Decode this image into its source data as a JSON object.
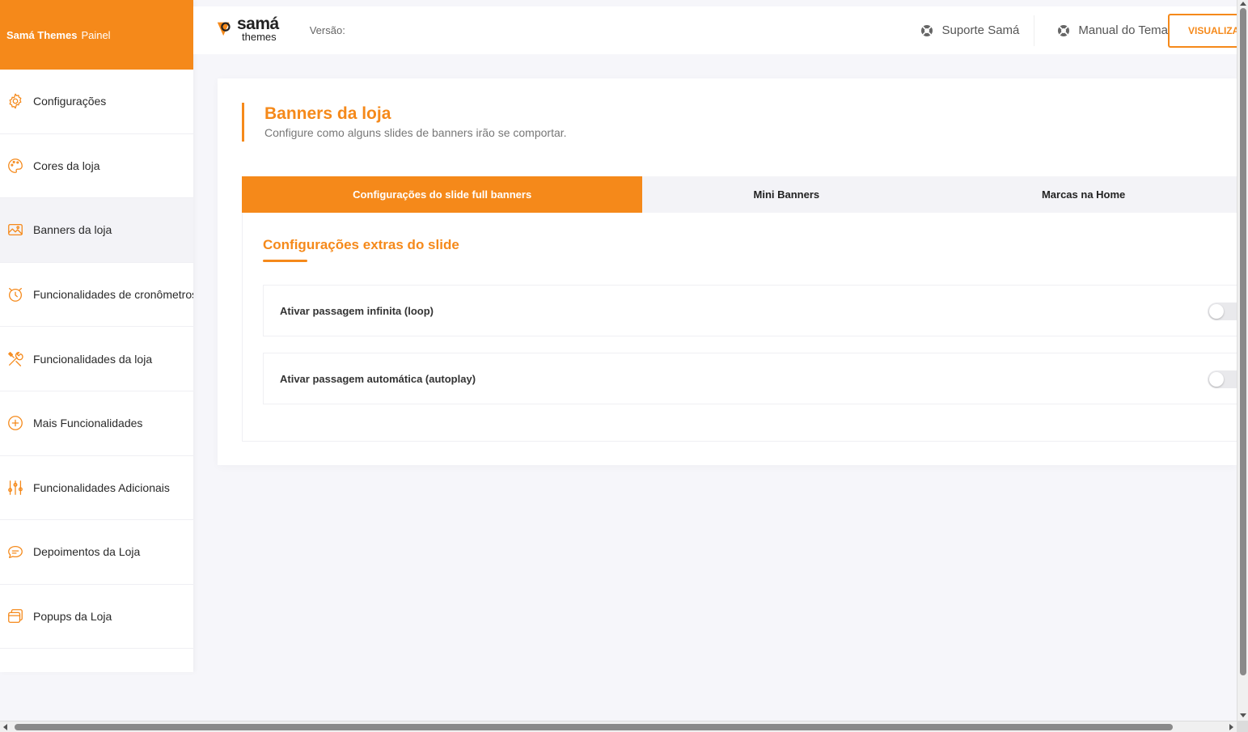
{
  "brand": {
    "name": "Samá Themes",
    "suffix": "Painel"
  },
  "colors": {
    "accent": "#f5891a",
    "background": "#f6f6fa"
  },
  "sidebar": {
    "items": [
      {
        "label": "Configurações",
        "icon": "gear-icon",
        "active": false
      },
      {
        "label": "Cores da loja",
        "icon": "palette-icon",
        "active": false
      },
      {
        "label": "Banners da loja",
        "icon": "image-icon",
        "active": true
      },
      {
        "label": "Funcionalidades de cronômetros",
        "icon": "alarm-clock-icon",
        "active": false
      },
      {
        "label": "Funcionalidades da loja",
        "icon": "tools-icon",
        "active": false
      },
      {
        "label": "Mais Funcionalidades",
        "icon": "plus-circle-icon",
        "active": false
      },
      {
        "label": "Funcionalidades Adicionais",
        "icon": "sliders-icon",
        "active": false
      },
      {
        "label": "Depoimentos da Loja",
        "icon": "chat-icon",
        "active": false
      },
      {
        "label": "Popups da Loja",
        "icon": "window-icon",
        "active": false
      }
    ]
  },
  "header": {
    "logo_line1": "samá",
    "logo_line2": "themes",
    "version_label": "Versão:",
    "links": [
      {
        "label": "Suporte Samá",
        "icon": "lifebuoy-icon"
      },
      {
        "label": "Manual do Tema",
        "icon": "lifebuoy-icon"
      }
    ],
    "visualize_button": "VISUALIZAR"
  },
  "page": {
    "title": "Banners da loja",
    "subtitle": "Configure como alguns slides de banners irão se comportar.",
    "tabs": [
      {
        "label": "Configurações do slide full banners",
        "active": true
      },
      {
        "label": "Mini Banners",
        "active": false
      },
      {
        "label": "Marcas na Home",
        "active": false
      }
    ],
    "section_title": "Configurações extras do slide",
    "options": [
      {
        "label": "Ativar passagem infinita (loop)",
        "enabled": false
      },
      {
        "label": "Ativar passagem automática (autoplay)",
        "enabled": false
      }
    ]
  }
}
